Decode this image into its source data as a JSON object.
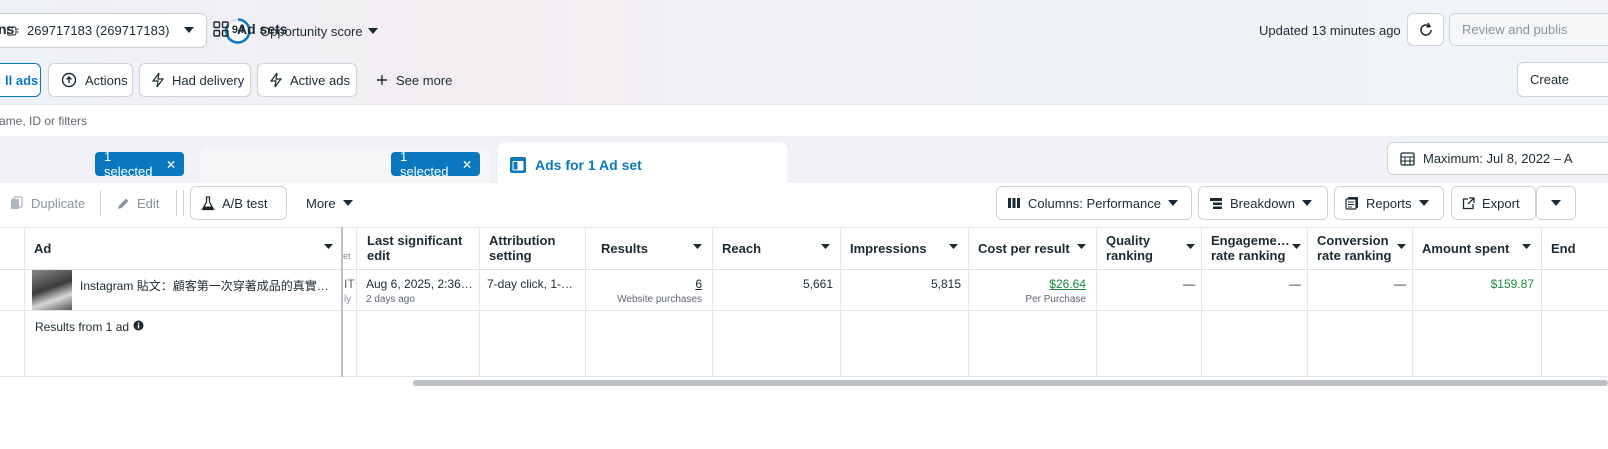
{
  "header": {
    "account_label": "269717183 (269717183)",
    "opportunity_score": "94",
    "opportunity_label": "Opportunity score",
    "updated_text": "Updated 13 minutes ago",
    "review_publish_label": "Review and publis"
  },
  "filters": {
    "all_ads": "ll ads",
    "actions": "Actions",
    "had_delivery": "Had delivery",
    "active_ads": "Active ads",
    "see_more": "See more",
    "create": "Create"
  },
  "search": {
    "placeholder": "ame, ID or filters"
  },
  "tabs": {
    "campaigns_label": "ns",
    "campaigns_selected": "1 selected",
    "adsets_label": "Ad sets",
    "adsets_selected": "1 selected",
    "ads_label": "Ads for 1 Ad set",
    "date_range": "Maximum: Jul 8, 2022 – A"
  },
  "toolbar": {
    "duplicate": "Duplicate",
    "edit": "Edit",
    "ab_test": "A/B test",
    "more": "More",
    "columns": "Columns: Performance",
    "breakdown": "Breakdown",
    "reports": "Reports",
    "export": "Export"
  },
  "table": {
    "headers": {
      "ad": "Ad",
      "last_edit": "Last significant edit",
      "attribution": "Attribution setting",
      "results": "Results",
      "reach": "Reach",
      "impressions": "Impressions",
      "cost_per_result": "Cost per result",
      "quality_ranking": "Quality ranking",
      "engagement": "Engageme… rate ranking",
      "conversion": "Conversion rate ranking",
      "amount_spent": "Amount spent",
      "ends": "End"
    },
    "partial_col": {
      "head": "et",
      "row_top": "IT",
      "row_sub": "ly"
    },
    "row": {
      "ad_name": "Instagram 貼文：顧客第一次穿著成品的真實…",
      "last_edit": "Aug 6, 2025, 2:36…",
      "last_edit_sub": "2 days ago",
      "attribution": "7-day click, 1-…",
      "results": "6",
      "results_sub": "Website purchases",
      "reach": "5,661",
      "impressions": "5,815",
      "cost_per_result": "$26.64",
      "cost_sub": "Per Purchase",
      "quality_ranking": "—",
      "engagement": "—",
      "conversion": "—",
      "amount_spent": "$159.87"
    },
    "summary": "Results from 1 ad"
  },
  "colors": {
    "accent": "#0a78be",
    "green": "#1b8a3b"
  }
}
